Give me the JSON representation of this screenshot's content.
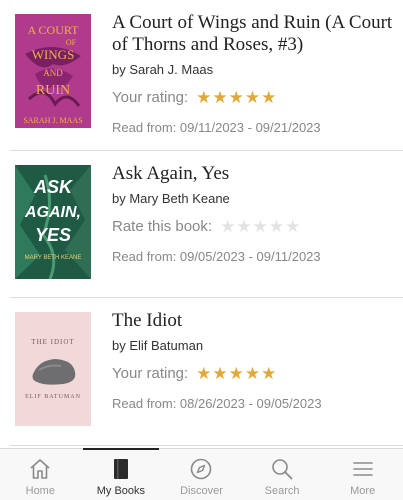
{
  "books": [
    {
      "title": "A Court of Wings and Ruin (A Court of Thorns and Roses, #3)",
      "author": "by Sarah J. Maas",
      "rating_label": "Your rating:",
      "rating": 5,
      "dates": "Read from: 09/11/2023 - 09/21/2023",
      "cover": {
        "bg": "#b03a8c",
        "text_color": "#f0b24a",
        "line1": "A COURT",
        "line2": "OF",
        "line3": "WINGS",
        "line4": "AND",
        "line5": "RUIN",
        "author": "SARAH J. MAAS"
      }
    },
    {
      "title": "Ask Again, Yes",
      "author": "by Mary Beth Keane",
      "rating_label": "Rate this book:",
      "rating": 0,
      "dates": "Read from: 09/05/2023 - 09/11/2023",
      "cover": {
        "bg": "#1f5a45",
        "text_color": "#ffffff",
        "line1": "ASK",
        "line2": "AGAIN,",
        "line3": "YES",
        "author": "MARY BETH KEANE"
      }
    },
    {
      "title": "The Idiot",
      "author": "by Elif Batuman",
      "rating_label": "Your rating:",
      "rating": 5,
      "dates": "Read from: 08/26/2023 - 09/05/2023",
      "cover": {
        "bg": "#f1d9d9",
        "text_color": "#7a5a5a",
        "line1": "THE IDIOT",
        "author": "ELIF BATUMAN"
      }
    }
  ],
  "tabs": [
    {
      "label": "Home",
      "icon": "home-icon",
      "active": false
    },
    {
      "label": "My Books",
      "icon": "book-icon",
      "active": true
    },
    {
      "label": "Discover",
      "icon": "compass-icon",
      "active": false
    },
    {
      "label": "Search",
      "icon": "search-icon",
      "active": false
    },
    {
      "label": "More",
      "icon": "menu-icon",
      "active": false
    }
  ],
  "colors": {
    "star": "#e0a93b",
    "star_empty": "#e3e3e3",
    "accent": "#222222"
  }
}
